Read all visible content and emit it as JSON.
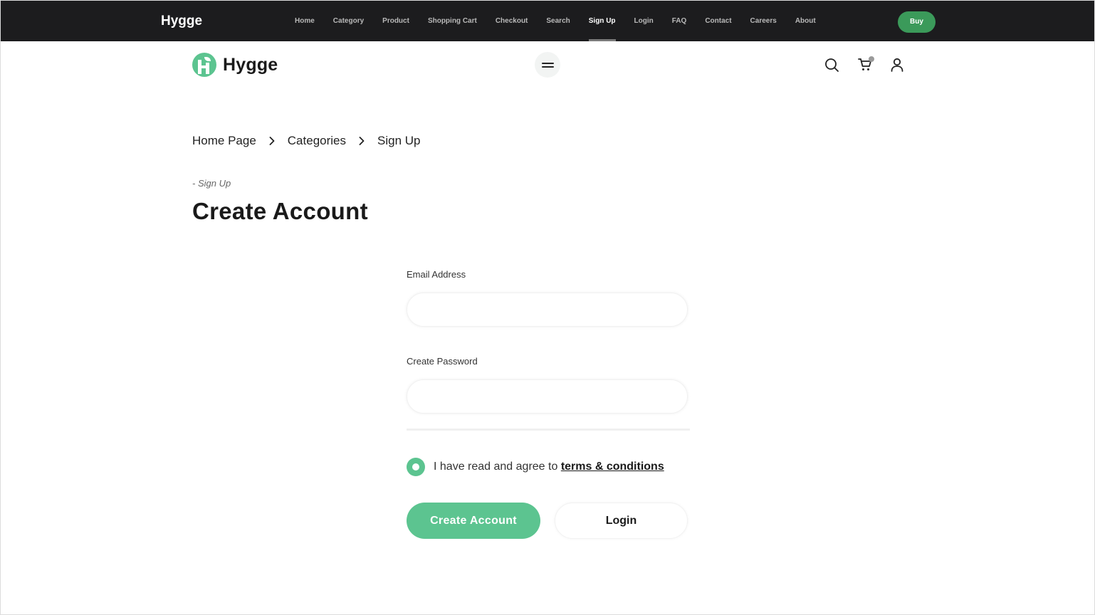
{
  "topbar": {
    "brand": "Hygge",
    "nav": [
      "Home",
      "Category",
      "Product",
      "Shopping Cart",
      "Checkout",
      "Search",
      "Sign Up",
      "Login",
      "FAQ",
      "Contact",
      "Careers",
      "About"
    ],
    "active_item": "Sign Up",
    "buy_label": "Buy",
    "buy_color": "#3b9a5a"
  },
  "header": {
    "logo_text": "Hygge",
    "icons": [
      "menu-icon",
      "search-icon",
      "cart-icon",
      "user-icon"
    ]
  },
  "breadcrumb": {
    "items": [
      "Home Page",
      "Categories",
      "Sign Up"
    ]
  },
  "page": {
    "eyebrow": "- Sign Up",
    "title": "Create Account"
  },
  "form": {
    "email_label": "Email Address",
    "email_value": "",
    "password_label": "Create Password",
    "password_value": "",
    "agree_text": "I have read and agree to",
    "terms_link": "terms & conditions",
    "create_button": "Create Account",
    "login_button": "Login"
  },
  "colors": {
    "accent": "#5cc490",
    "topbar_bg": "#1c1c1e"
  }
}
